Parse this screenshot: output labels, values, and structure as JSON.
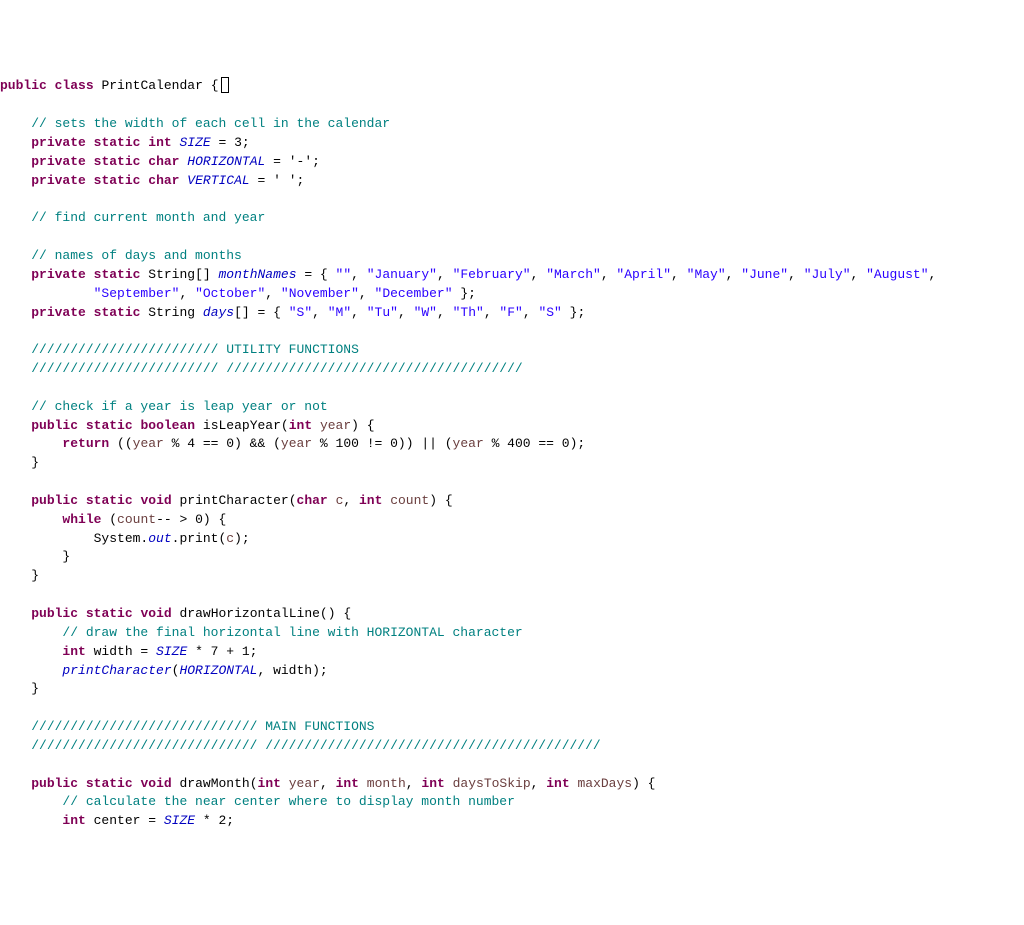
{
  "line1_kw1": "public",
  "line1_kw2": "class",
  "line1_name": "PrintCalendar",
  "line1_brace": "{",
  "cmt_width": "// sets the width of each cell in the calendar",
  "kw_private": "private",
  "kw_static": "static",
  "kw_int": "int",
  "fld_SIZE": "SIZE",
  "eq3": " = 3;",
  "kw_char": "char",
  "fld_HORIZ": "HORIZONTAL",
  "eq_dash": " = '-';",
  "fld_VERT": "VERTICAL",
  "eq_space": " = ' ';",
  "cmt_find": "// find current month and year",
  "cmt_names": "// names of days and months",
  "type_StringArr": "String[]",
  "fld_monthNames": "monthNames",
  "mn_open": " = { ",
  "s_empty": "\"\"",
  "s_jan": "\"January\"",
  "s_feb": "\"February\"",
  "s_mar": "\"March\"",
  "s_apr": "\"April\"",
  "s_may": "\"May\"",
  "s_jun": "\"June\"",
  "s_jul": "\"July\"",
  "s_aug": "\"August\"",
  "s_sep": "\"September\"",
  "s_oct": "\"October\"",
  "s_nov": "\"November\"",
  "s_dec": "\"December\"",
  "mn_close": " };",
  "type_String": "String",
  "fld_days": "days",
  "days_open": "[] = { ",
  "s_S": "\"S\"",
  "s_M": "\"M\"",
  "s_Tu": "\"Tu\"",
  "s_W": "\"W\"",
  "s_Th": "\"Th\"",
  "s_F": "\"F\"",
  "s_S2": "\"S\"",
  "days_close": " };",
  "cmt_util1": "//////////////////////// UTILITY FUNCTIONS",
  "cmt_util2": "//////////////////////// //////////////////////////////////////",
  "cmt_leap": "// check if a year is leap year or not",
  "kw_public": "public",
  "kw_boolean": "boolean",
  "fn_isLeap": "isLeapYear(",
  "p_year": "year",
  "close_paren_brace": ") {",
  "kw_return": "return",
  "leap_a": " ((",
  "leap_b": " % 4 == 0) && (",
  "leap_c": " % 100 != 0)) || (",
  "leap_d": " % 400 == 0);",
  "brace_close": "}",
  "kw_void": "void",
  "fn_printChar": "printCharacter(",
  "p_c": "c",
  "comma_sp": ", ",
  "p_count": "count",
  "kw_while": "while",
  "while_cond_a": " (",
  "while_cond_b": "-- > 0) {",
  "sys_a": "System.",
  "sys_out": "out",
  "sys_b": ".print(",
  "sys_c": ");",
  "fn_drawH": "drawHorizontalLine() {",
  "cmt_drawH": "// draw the final horizontal line with HORIZONTAL character",
  "width_a": " width = ",
  "width_b": " * 7 + 1;",
  "call_pc_a": "printCharacter",
  "call_pc_b": "(",
  "call_pc_c": ", width);",
  "cmt_main1": "///////////////////////////// MAIN FUNCTIONS",
  "cmt_main2": "///////////////////////////// ///////////////////////////////////////////",
  "fn_drawMonth": "drawMonth(",
  "p_month": "month",
  "p_daysToSkip": "daysToSkip",
  "p_maxDays": "maxDays",
  "cmt_center": "// calculate the near center where to display month number",
  "center_a": " center = ",
  "center_b": " * 2;"
}
